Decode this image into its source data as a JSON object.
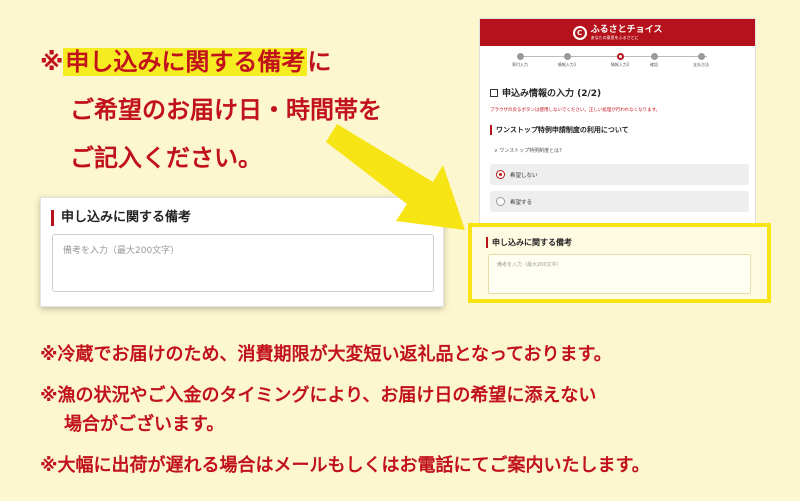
{
  "headline": {
    "prefix": "※",
    "highlight": "申し込みに関する備考",
    "after": "に",
    "line2": "ご希望のお届け日・時間帯を",
    "line3": "ご記入ください。"
  },
  "zoom_form": {
    "title": "申し込みに関する備考",
    "placeholder": "備考を入力（最大200文字）"
  },
  "phone": {
    "logo_name": "ふるさとチョイス",
    "logo_sub": "あなたの意思をふるさとに",
    "steps": [
      "寄付入力",
      "情報入力1",
      "情報入力2",
      "確認",
      "支払方法"
    ],
    "active_step": 2,
    "section_title": "申込み情報の入力 (2/2)",
    "warning": "ブラウザの戻るボタンは使用しないでください。正しい処理が行われなくなります。",
    "block_title": "ワンストップ特例申請制度の利用について",
    "link": "ワンストップ特例制度とは?",
    "options": [
      {
        "label": "希望しない",
        "checked": true
      },
      {
        "label": "希望する",
        "checked": false
      }
    ],
    "remarks_title": "申し込みに関する備考",
    "remarks_placeholder": "備考を入力（最大200文字）"
  },
  "notes": {
    "n1": "※冷蔵でお届けのため、消費期限が大変短い返礼品となっております。",
    "n2a": "※漁の状況やご入金のタイミングにより、お届け日の希望に添えない",
    "n2b": "場合がございます。",
    "n3": "※大幅に出荷が遅れる場合はメールもしくはお電話にてご案内いたします。"
  },
  "colors": {
    "background": "#fdf7cf",
    "accent_red": "#c1121c",
    "highlight_yellow": "#f6ec22",
    "brand_red": "#b5121b"
  }
}
